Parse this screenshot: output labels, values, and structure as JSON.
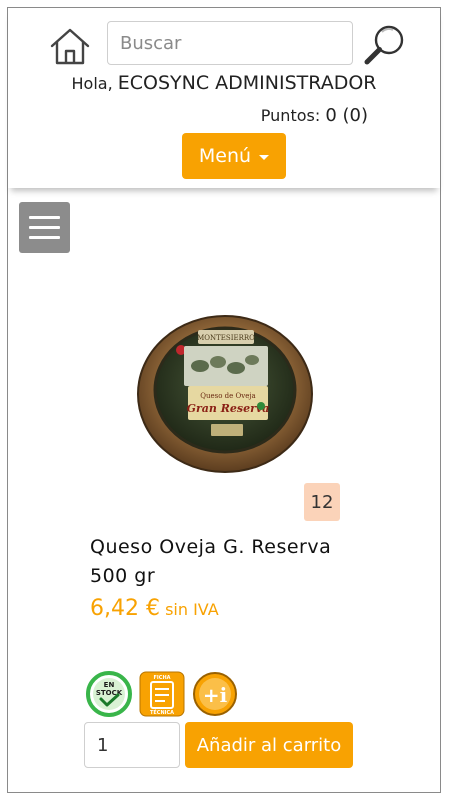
{
  "header": {
    "search": {
      "placeholder": "Buscar",
      "value": ""
    },
    "greeting_prefix": "Hola,",
    "user_name": "ECOSYNC ADMINISTRADOR",
    "points_label": "Puntos:",
    "points_value": "0 (0)",
    "menu_label": "Menú"
  },
  "product": {
    "badge_value": "12",
    "name_line1": "Queso Oveja G. Reserva",
    "name_line2": "500 gr",
    "price_amount": "6,42 €",
    "price_vat": "sin IVA",
    "label_lettering": {
      "brand": "MONTESIERRO",
      "type": "Queso de Oveja",
      "grade": "Gran Reserva"
    },
    "status_icons": {
      "stock": {
        "line1": "EN",
        "line2": "STOCK"
      },
      "sheet": {
        "line1": "FICHA",
        "line2": "TÉCNICA"
      },
      "info": {
        "text": "+i"
      }
    }
  },
  "cart": {
    "quantity": "1",
    "add_label": "Añadir al carrito"
  },
  "colors": {
    "accent": "#f8a202",
    "badge_bg": "#fbd3b9",
    "hamburger_bg": "#8c8c8c",
    "stock_green": "#39b54a"
  },
  "icons": [
    "home-icon",
    "search-icon",
    "caret-down-icon",
    "hamburger-icon",
    "stock-icon",
    "technical-sheet-icon",
    "info-icon"
  ]
}
